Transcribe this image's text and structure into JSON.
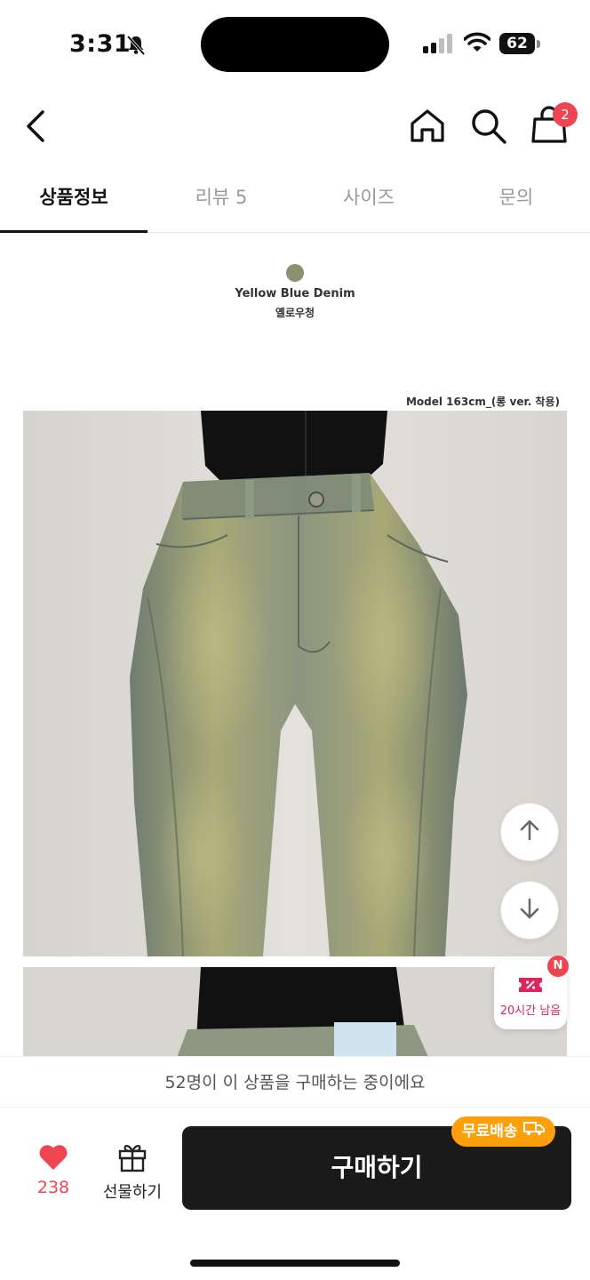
{
  "status_bar": {
    "time": "3:31",
    "battery": "62"
  },
  "nav": {
    "cart_count": "2"
  },
  "tabs": [
    {
      "label": "상품정보",
      "active": true
    },
    {
      "label": "리뷰 5",
      "active": false
    },
    {
      "label": "사이즈",
      "active": false
    },
    {
      "label": "문의",
      "active": false
    }
  ],
  "product": {
    "color_name": "Yellow Blue Denim",
    "color_kr": "옐로우청",
    "color_hex": "#8c9070",
    "model_note": "Model 163cm_(롱 ver. 착용)"
  },
  "coupon": {
    "label": "20시간 남음",
    "badge": "N"
  },
  "buying_banner": "52명이 이 상품을 구매하는 중이에요",
  "bottom_bar": {
    "like_count": "238",
    "gift_label": "선물하기",
    "buy_label": "구매하기",
    "free_shipping": "무료배송"
  },
  "colors": {
    "accent_red": "#f04452",
    "free_ship_orange": "#ff9f0a",
    "buy_button": "#1a1a1a"
  }
}
